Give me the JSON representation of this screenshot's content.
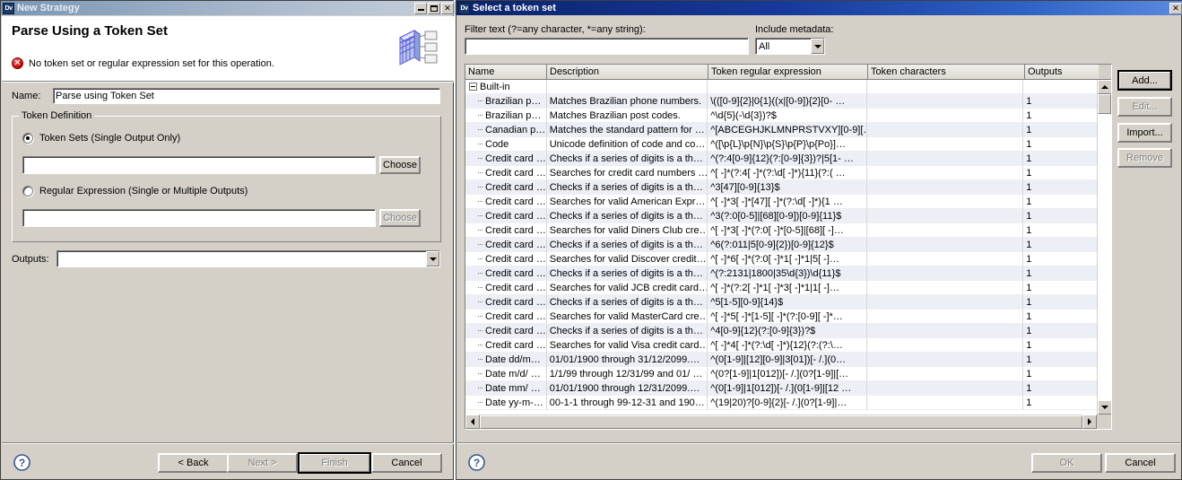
{
  "left_dialog": {
    "titlebar": {
      "app_badge": "Dv",
      "title": "New Strategy",
      "minimize": "_",
      "maximize": "□",
      "close": "✕"
    },
    "banner": {
      "heading": "Parse Using a Token Set",
      "message": "No token set or regular expression set for this operation.",
      "error_glyph": "✕"
    },
    "name_label": "Name:",
    "name_value": "Parse using Token Set",
    "token_definition": {
      "group_label": "Token Definition",
      "token_sets_radio_label": "Token Sets (Single Output Only)",
      "token_sets_value": "",
      "token_sets_choose": "Choose",
      "regex_radio_label": "Regular Expression (Single or Multiple Outputs)",
      "regex_value": "",
      "regex_choose": "Choose"
    },
    "outputs_label": "Outputs:",
    "outputs_value": "",
    "buttons": {
      "help": "?",
      "back": "< Back",
      "next": "Next >",
      "finish": "Finish",
      "cancel": "Cancel"
    }
  },
  "right_dialog": {
    "titlebar": {
      "app_badge": "Dv",
      "title": "Select a token set",
      "close": "✕"
    },
    "filter_label": "Filter text (?=any character, *=any string):",
    "filter_value": "",
    "metadata_label": "Include metadata:",
    "metadata_value": "All",
    "columns": [
      "Name",
      "Description",
      "Token regular expression",
      "Token characters",
      "Outputs"
    ],
    "group_row": {
      "label": "Built-in",
      "expanded": true
    },
    "rows": [
      {
        "name": "Brazilian p…",
        "description": "Matches Brazilian phone numbers.",
        "regex": "\\(([0-9]{2}|0{1}((x|[0-9]){2}[0- …",
        "chars": "",
        "outputs": "1"
      },
      {
        "name": "Brazilian p…",
        "description": "Matches Brazilian post codes.",
        "regex": "^\\d{5}(-\\d{3})?$",
        "chars": "",
        "outputs": "1"
      },
      {
        "name": "Canadian p…",
        "description": "Matches the standard pattern for …",
        "regex": "^[ABCEGHJKLMNPRSTVXY][0-9][…",
        "chars": "",
        "outputs": "1"
      },
      {
        "name": "Code",
        "description": "Unicode definition of code and co…",
        "regex": "^([\\p{L}\\p{N}\\p{S}\\p{P}\\p{Po}]…",
        "chars": "",
        "outputs": "1"
      },
      {
        "name": "Credit card …",
        "description": "Checks if a series of digits is a th…",
        "regex": "^(?:4[0-9]{12}(?:[0-9]{3})?|5[1- …",
        "chars": "",
        "outputs": "1"
      },
      {
        "name": "Credit card …",
        "description": "Searches for credit card numbers …",
        "regex": "^[ -]*(?:4[ -]*(?:\\d[ -]*){11}(?:( …",
        "chars": "",
        "outputs": "1"
      },
      {
        "name": "Credit card …",
        "description": "Checks if a series of digits is a th…",
        "regex": "^3[47][0-9]{13}$",
        "chars": "",
        "outputs": "1"
      },
      {
        "name": "Credit card …",
        "description": "Searches for valid American Expr…",
        "regex": "^[ -]*3[ -]*[47][ -]*(?:\\d[ -]*){1 …",
        "chars": "",
        "outputs": "1"
      },
      {
        "name": "Credit card …",
        "description": "Checks if a series of digits is a th…",
        "regex": "^3(?:0[0-5]|[68][0-9])[0-9]{11}$",
        "chars": "",
        "outputs": "1"
      },
      {
        "name": "Credit card …",
        "description": "Searches for valid Diners Club cre…",
        "regex": "^[ -]*3[ -]*(?:0[ -]*[0-5]|[68][ -]…",
        "chars": "",
        "outputs": "1"
      },
      {
        "name": "Credit card …",
        "description": "Checks if a series of digits is a th…",
        "regex": "^6(?:011|5[0-9]{2})[0-9]{12}$",
        "chars": "",
        "outputs": "1"
      },
      {
        "name": "Credit card …",
        "description": "Searches for valid Discover credit…",
        "regex": "^[ -]*6[ -]*(?:0[ -]*1[ -]*1|5[ -]…",
        "chars": "",
        "outputs": "1"
      },
      {
        "name": "Credit card …",
        "description": "Checks if a series of digits is a th…",
        "regex": "^(?:2131|1800|35\\d{3})\\d{11}$",
        "chars": "",
        "outputs": "1"
      },
      {
        "name": "Credit card …",
        "description": "Searches for valid JCB credit card…",
        "regex": "^[ -]*(?:2[ -]*1[ -]*3[ -]*1|1[ -]…",
        "chars": "",
        "outputs": "1"
      },
      {
        "name": "Credit card …",
        "description": "Checks if a series of digits is a th…",
        "regex": "^5[1-5][0-9]{14}$",
        "chars": "",
        "outputs": "1"
      },
      {
        "name": "Credit card …",
        "description": "Searches for valid MasterCard cre…",
        "regex": "^[ -]*5[ -]*[1-5][ -]*(?:[0-9][ -]*…",
        "chars": "",
        "outputs": "1"
      },
      {
        "name": "Credit card …",
        "description": "Checks if a series of digits is a th…",
        "regex": "^4[0-9]{12}(?:[0-9]{3})?$",
        "chars": "",
        "outputs": "1"
      },
      {
        "name": "Credit card …",
        "description": "Searches for valid Visa credit card…",
        "regex": "^[ -]*4[ -]*(?:\\d[ -]*){12}(?:(?:\\…",
        "chars": "",
        "outputs": "1"
      },
      {
        "name": "Date dd/m…",
        "description": "01/01/1900 through 31/12/2099.…",
        "regex": "^(0[1-9]|[12][0-9]|3[01])[- /.](0…",
        "chars": "",
        "outputs": "1"
      },
      {
        "name": "Date m/d/ …",
        "description": "1/1/99 through 12/31/99 and 01/ …",
        "regex": "^(0?[1-9]|1[012])[- /.](0?[1-9]|[…",
        "chars": "",
        "outputs": "1"
      },
      {
        "name": "Date mm/ …",
        "description": "01/01/1900 through 12/31/2099.…",
        "regex": "^(0[1-9]|1[012])[- /.](0[1-9]|[12 …",
        "chars": "",
        "outputs": "1"
      },
      {
        "name": "Date yy-m-…",
        "description": "00-1-1 through 99-12-31 and 190…",
        "regex": "^(19|20)?[0-9]{2}[- /.](0?[1-9]|…",
        "chars": "",
        "outputs": "1"
      }
    ],
    "side_buttons": {
      "add": "Add...",
      "edit": "Edit...",
      "import": "Import...",
      "remove": "Remove"
    },
    "buttons": {
      "help": "?",
      "ok": "OK",
      "cancel": "Cancel"
    }
  },
  "colors": {
    "dialog_face": "#d4d0c8",
    "title_active": "#0a246a",
    "title_inactive": "#7a96b4",
    "row_alt": "#eceff5",
    "error_red": "#c00000"
  }
}
